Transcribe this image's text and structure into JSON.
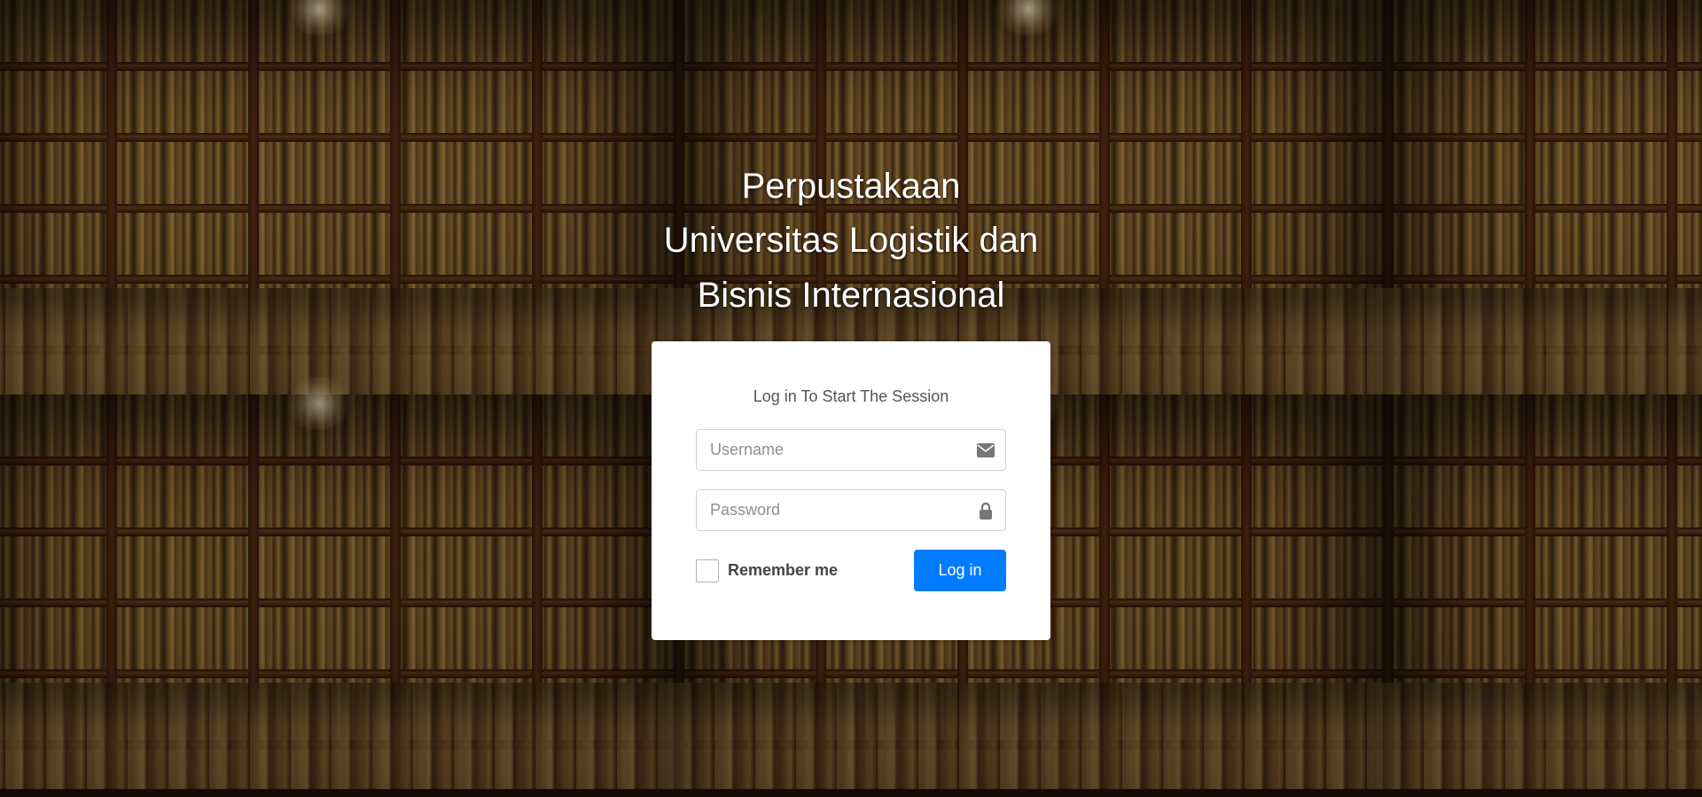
{
  "header": {
    "line1": "Perpustakaan",
    "line2": "Universitas Logistik dan",
    "line3": "Bisnis Internasional"
  },
  "login": {
    "message": "Log in To Start The Session",
    "username_placeholder": "Username",
    "username_value": "",
    "username_icon": "envelope-icon",
    "password_placeholder": "Password",
    "password_value": "",
    "password_icon": "lock-icon",
    "remember_label": "Remember me",
    "remember_checked": false,
    "submit_label": "Log in"
  },
  "colors": {
    "primary": "#007bff",
    "card_bg": "#ffffff",
    "heading_text": "#ffffff"
  }
}
